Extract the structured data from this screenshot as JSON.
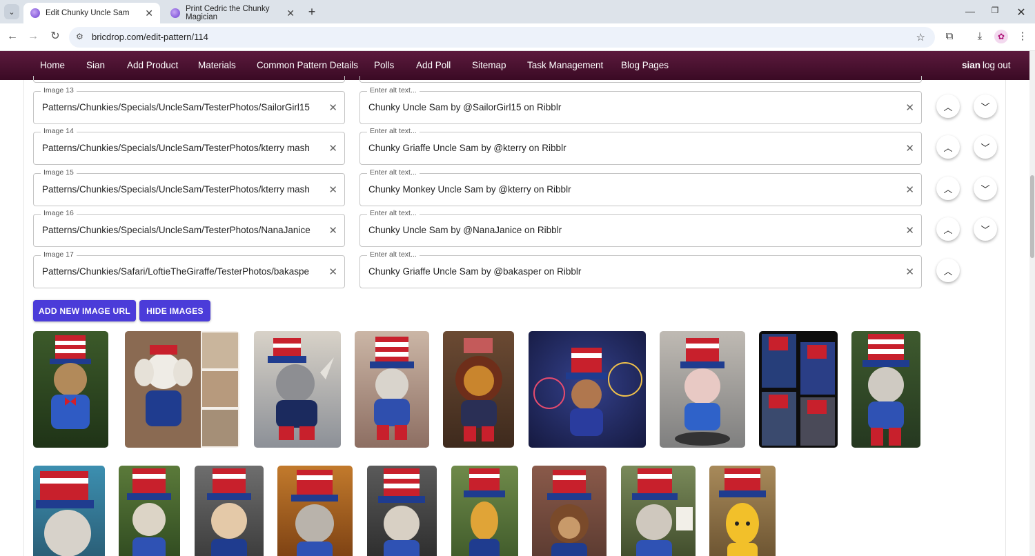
{
  "browser": {
    "tabs": [
      {
        "title": "Edit Chunky Uncle Sam",
        "active": true
      },
      {
        "title": "Print Cedric the Chunky Magician",
        "active": false
      }
    ],
    "url": "bricdrop.com/edit-pattern/114"
  },
  "nav": {
    "items": [
      "Home",
      "Sian",
      "Add Product",
      "Materials",
      "Common Pattern Details",
      "Polls",
      "Add Poll",
      "Sitemap",
      "Task Management",
      "Blog Pages"
    ],
    "user": "sian",
    "logout": "log out"
  },
  "images": [
    {
      "label": "Image 13",
      "url": "Patterns/Chunkies/Specials/UncleSam/TesterPhotos/SailorGirl15",
      "alt_label": "Enter alt text...",
      "alt": "Chunky Uncle Sam by @SailorGirl15  on Ribblr"
    },
    {
      "label": "Image 14",
      "url": "Patterns/Chunkies/Specials/UncleSam/TesterPhotos/kterry mash",
      "alt_label": "Enter alt text...",
      "alt": "Chunky Griaffe Uncle Sam by @kterry on Ribblr"
    },
    {
      "label": "Image 15",
      "url": "Patterns/Chunkies/Specials/UncleSam/TesterPhotos/kterry mash",
      "alt_label": "Enter alt text...",
      "alt": "Chunky Monkey Uncle Sam by @kterry on Ribblr"
    },
    {
      "label": "Image 16",
      "url": "Patterns/Chunkies/Specials/UncleSam/TesterPhotos/NanaJanice",
      "alt_label": "Enter alt text...",
      "alt": "Chunky Uncle Sam by @NanaJanice on Ribblr"
    },
    {
      "label": "Image 17",
      "url": "Patterns/Chunkies/Safari/LoftieTheGiraffe/TesterPhotos/bakaspe",
      "alt_label": "Enter alt text...",
      "alt": "Chunky Griaffe Uncle Sam by @bakasper on Ribblr"
    }
  ],
  "buttons": {
    "add_image": "ADD NEW IMAGE URL",
    "hide_images": "HIDE IMAGES"
  },
  "colors": {
    "nav_bg": "#4a1030",
    "primary_button": "#4b3cd9",
    "hat_red": "#c8202c",
    "hat_blue": "#1f3c8f"
  }
}
